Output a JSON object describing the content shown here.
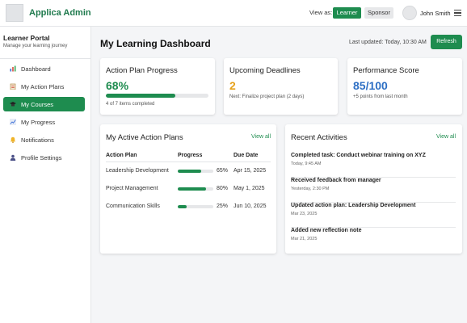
{
  "header": {
    "brand": "Applica Admin",
    "view_as_label": "View as:",
    "role_learner": "Learner",
    "role_sponsor": "Sponsor",
    "user_name": "John Smith"
  },
  "sidebar": {
    "title": "Learner Portal",
    "subtitle": "Manage your learning journey",
    "items": [
      {
        "label": "Dashboard",
        "icon": "chart-icon"
      },
      {
        "label": "My Action Plans",
        "icon": "clipboard-icon"
      },
      {
        "label": "My Courses",
        "icon": "graduation-cap-icon",
        "active": true
      },
      {
        "label": "My Progress",
        "icon": "trend-icon"
      },
      {
        "label": "Notifications",
        "icon": "bell-icon"
      },
      {
        "label": "Profile Settings",
        "icon": "user-icon"
      }
    ]
  },
  "main": {
    "title": "My Learning Dashboard",
    "last_updated": "Last updated: Today, 10:30 AM",
    "refresh_label": "Refresh"
  },
  "stats": {
    "progress": {
      "title": "Action Plan Progress",
      "value": "68%",
      "fraction": 0.68,
      "note": "4 of 7 items completed"
    },
    "deadlines": {
      "title": "Upcoming Deadlines",
      "value": "2",
      "note": "Next: Finalize project plan (2 days)"
    },
    "score": {
      "title": "Performance Score",
      "value": "85/100",
      "note": "+5 points from last month"
    }
  },
  "action_plans": {
    "title": "My Active Action Plans",
    "view_all": "View all",
    "columns": [
      "Action Plan",
      "Progress",
      "Due Date"
    ],
    "rows": [
      {
        "name": "Leadership Development",
        "progress": 0.65,
        "progress_label": "65%",
        "due": "Apr 15, 2025"
      },
      {
        "name": "Project Management",
        "progress": 0.8,
        "progress_label": "80%",
        "due": "May 1, 2025"
      },
      {
        "name": "Communication Skills",
        "progress": 0.25,
        "progress_label": "25%",
        "due": "Jun 10, 2025"
      }
    ]
  },
  "activities": {
    "title": "Recent Activities",
    "view_all": "View all",
    "items": [
      {
        "title": "Completed task: Conduct webinar training on XYZ",
        "date": "Today, 9:45 AM"
      },
      {
        "title": "Received feedback from manager",
        "date": "Yesterday, 2:30 PM"
      },
      {
        "title": "Updated action plan: Leadership Development",
        "date": "Mar 23, 2025"
      },
      {
        "title": "Added new reflection note",
        "date": "Mar 21, 2025"
      }
    ]
  },
  "colors": {
    "accent": "#1e8c4f",
    "deadline": "#e6a11a",
    "score": "#2d6fc4"
  }
}
